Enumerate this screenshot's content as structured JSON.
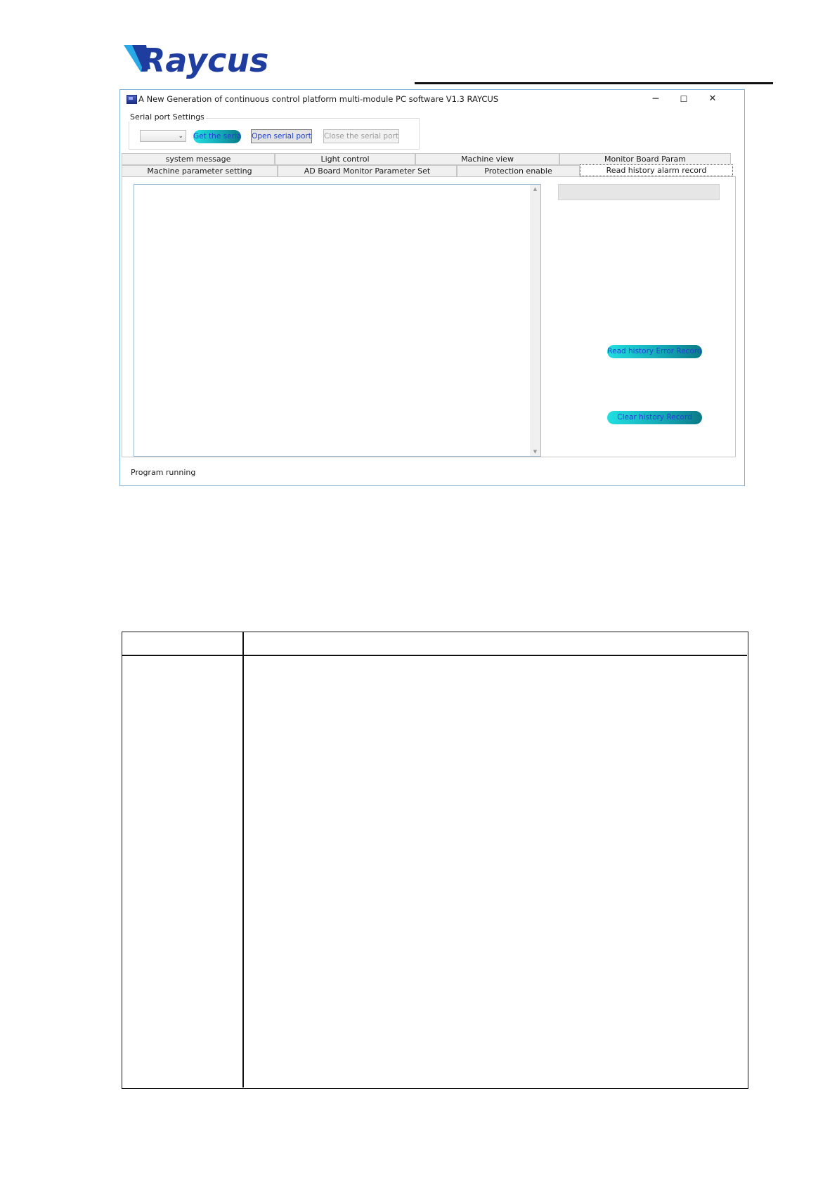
{
  "brand": {
    "logo_text": "Raycus",
    "logo_color": "#1f3d9e"
  },
  "window": {
    "title": "A New Generation of continuous control platform multi-module PC software V1.3 RAYCUS",
    "controls": {
      "minimize": "─",
      "maximize": "☐",
      "close": "✕"
    }
  },
  "serial_port": {
    "legend": "Serial port Settings",
    "port_value": "",
    "get_serial_label": "Get the serial",
    "open_label": "Open serial port",
    "close_label": "Close the serial port"
  },
  "tabs": {
    "row1": [
      "system message",
      "Light control",
      "Machine view",
      "Monitor Board Param"
    ],
    "row2": [
      "Machine parameter setting",
      "AD Board Monitor Parameter Set",
      "Protection enable",
      "Read history alarm record"
    ],
    "active": "Read history alarm record"
  },
  "history_panel": {
    "record_field_value": "",
    "read_button_label": "Read history Error Record",
    "clear_button_label": "Clear history Record"
  },
  "status": {
    "text": "Program running"
  },
  "colors": {
    "accent_button": "#13a6b4",
    "button_text": "#2440d0",
    "window_border": "#7fb0d8"
  },
  "icons": {
    "window": "app-window-icon",
    "dropdown": "chevron-down-icon"
  }
}
